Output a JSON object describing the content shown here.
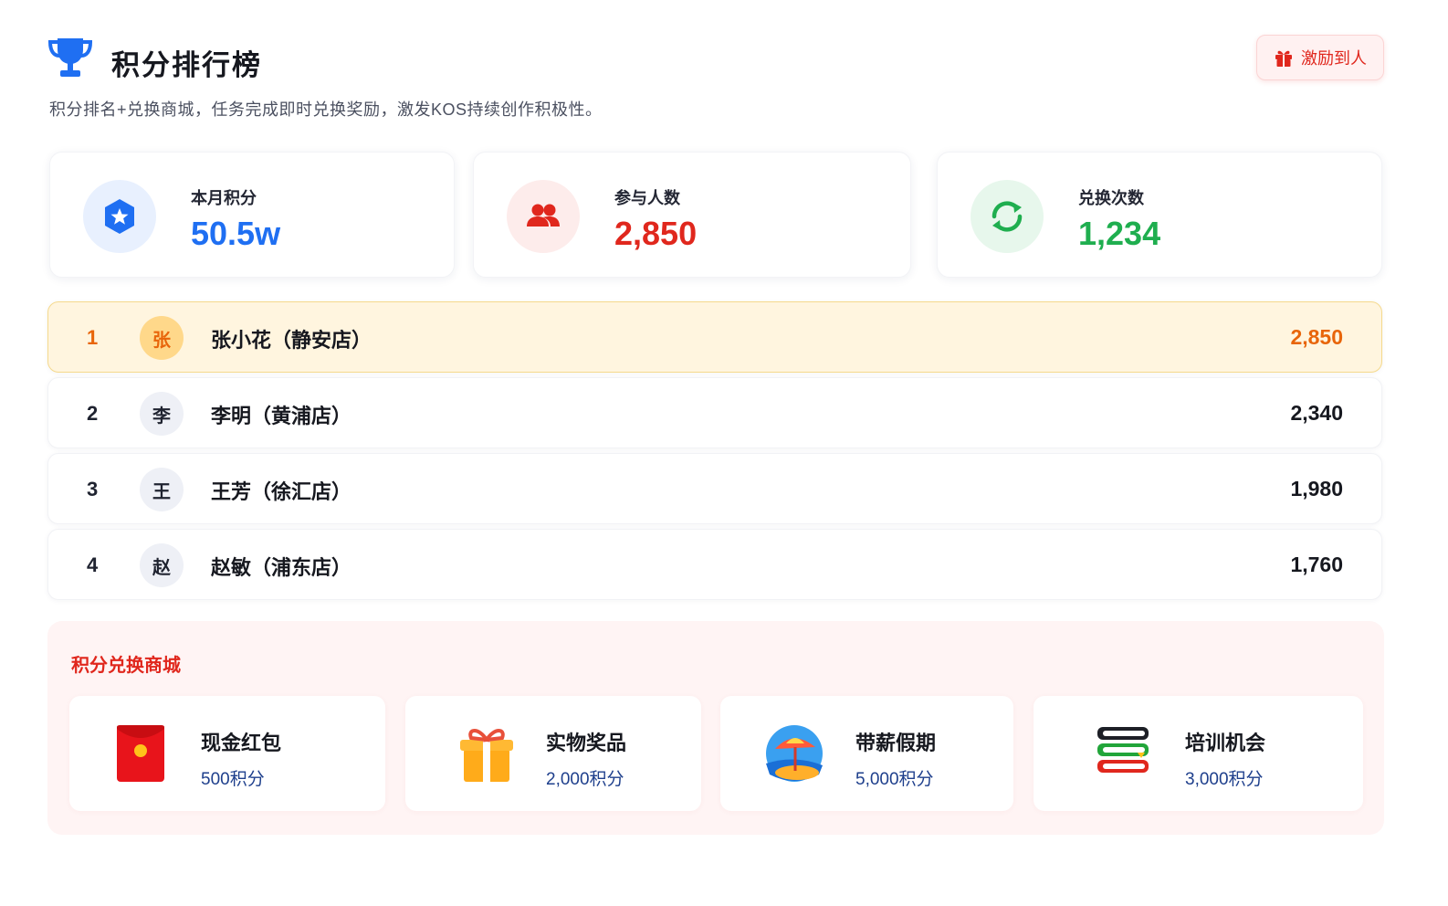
{
  "header": {
    "title": "积分排行榜",
    "icon": "trophy-icon",
    "subtitle": "积分排名+兑换商城，任务完成即时兑换奖励，激发KOS持续创作积极性。",
    "reward_button": {
      "label": "激励到人",
      "icon": "gift-icon"
    }
  },
  "stats": [
    {
      "label": "本月积分",
      "value": "50.5w",
      "icon": "star-shield-icon",
      "color": "#1f6ff2"
    },
    {
      "label": "参与人数",
      "value": "2,850",
      "icon": "users-icon",
      "color": "#e0271d"
    },
    {
      "label": "兑换次数",
      "value": "1,234",
      "icon": "refresh-icon",
      "color": "#1fae4f"
    }
  ],
  "ranking": [
    {
      "rank": "1",
      "avatar": "张",
      "name": "张小花（静安店）",
      "score": "2,850"
    },
    {
      "rank": "2",
      "avatar": "李",
      "name": "李明（黄浦店）",
      "score": "2,340"
    },
    {
      "rank": "3",
      "avatar": "王",
      "name": "王芳（徐汇店）",
      "score": "1,980"
    },
    {
      "rank": "4",
      "avatar": "赵",
      "name": "赵敏（浦东店）",
      "score": "1,760"
    }
  ],
  "store": {
    "title": "积分兑换商城",
    "items": [
      {
        "name": "现金红包",
        "cost": "500积分",
        "icon": "red-envelope-icon"
      },
      {
        "name": "实物奖品",
        "cost": "2,000积分",
        "icon": "gift-box-icon"
      },
      {
        "name": "带薪假期",
        "cost": "5,000积分",
        "icon": "beach-umbrella-icon"
      },
      {
        "name": "培训机会",
        "cost": "3,000积分",
        "icon": "books-icon"
      }
    ]
  },
  "colors": {
    "accent_blue": "#1f6ff2",
    "accent_red": "#e0271d",
    "accent_green": "#1fae4f",
    "first_place": "#e8650a"
  }
}
